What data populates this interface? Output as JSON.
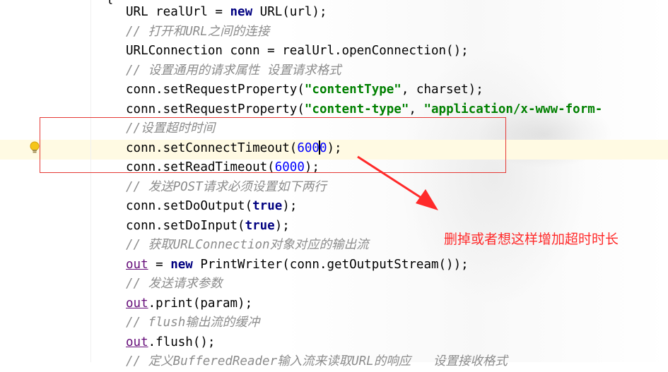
{
  "editor": {
    "lines": [
      {
        "id": "l1",
        "parts": [
          {
            "t": "URL realUrl = "
          },
          {
            "t": "new",
            "c": "kw"
          },
          {
            "t": " URL(url);"
          }
        ]
      },
      {
        "id": "l2",
        "parts": [
          {
            "t": "// 打开和URL之间的连接",
            "c": "cm"
          }
        ]
      },
      {
        "id": "l3",
        "parts": [
          {
            "t": "URLConnection conn = realUrl.openConnection();"
          }
        ]
      },
      {
        "id": "l4",
        "parts": [
          {
            "t": "// 设置通用的请求属性 设置请求格式",
            "c": "cm"
          }
        ]
      },
      {
        "id": "l5",
        "parts": [
          {
            "t": "conn.setRequestProperty("
          },
          {
            "t": "\"contentType\"",
            "c": "str"
          },
          {
            "t": ", charset);"
          }
        ]
      },
      {
        "id": "l6",
        "parts": [
          {
            "t": "conn.setRequestProperty("
          },
          {
            "t": "\"content-type\"",
            "c": "str"
          },
          {
            "t": ", "
          },
          {
            "t": "\"application/x-www-form-",
            "c": "str"
          }
        ]
      },
      {
        "id": "l7",
        "parts": [
          {
            "t": "//设置超时时间",
            "c": "cm"
          }
        ]
      },
      {
        "id": "l8",
        "parts": [
          {
            "t": "conn.setConnectTimeout("
          },
          {
            "t": "6000",
            "c": "num",
            "caret": true
          },
          {
            "t": ");"
          }
        ]
      },
      {
        "id": "l9",
        "parts": [
          {
            "t": "conn.setReadTimeout("
          },
          {
            "t": "6000",
            "c": "num"
          },
          {
            "t": ");"
          }
        ]
      },
      {
        "id": "l10",
        "parts": [
          {
            "t": "// 发送POST请求必须设置如下两行",
            "c": "cm"
          }
        ]
      },
      {
        "id": "l11",
        "parts": [
          {
            "t": "conn.setDoOutput("
          },
          {
            "t": "true",
            "c": "kw"
          },
          {
            "t": ");"
          }
        ]
      },
      {
        "id": "l12",
        "parts": [
          {
            "t": "conn.setDoInput("
          },
          {
            "t": "true",
            "c": "kw"
          },
          {
            "t": ");"
          }
        ]
      },
      {
        "id": "l13",
        "parts": [
          {
            "t": "// 获取URLConnection对象对应的输出流",
            "c": "cm"
          }
        ]
      },
      {
        "id": "l14",
        "parts": [
          {
            "t": "out",
            "c": "fld"
          },
          {
            "t": " = "
          },
          {
            "t": "new",
            "c": "kw"
          },
          {
            "t": " PrintWriter(conn.getOutputStream());"
          }
        ]
      },
      {
        "id": "l15",
        "parts": [
          {
            "t": "// 发送请求参数",
            "c": "cm"
          }
        ]
      },
      {
        "id": "l16",
        "parts": [
          {
            "t": "out",
            "c": "fld"
          },
          {
            "t": ".print(param);"
          }
        ]
      },
      {
        "id": "l17",
        "parts": [
          {
            "t": "// flush输出流的缓冲",
            "c": "cm"
          }
        ]
      },
      {
        "id": "l18",
        "parts": [
          {
            "t": "out",
            "c": "fld"
          },
          {
            "t": ".flush();"
          }
        ]
      },
      {
        "id": "l19",
        "parts": [
          {
            "t": "// 定义BufferedReader输入流来读取URL的响应   设置接收格式",
            "c": "cm"
          }
        ]
      }
    ]
  },
  "annotation": {
    "note": "删掉或者想这样增加超时时长",
    "color": "#ff2a2a"
  },
  "gutter": {
    "bulb_icon": "lightbulb-intention-icon"
  }
}
